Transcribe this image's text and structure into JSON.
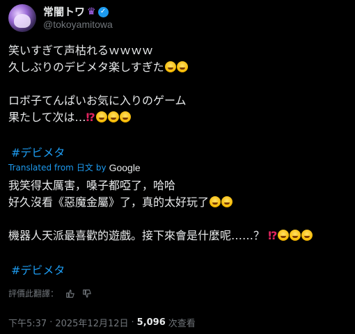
{
  "author": {
    "display_name": "常闇トワ",
    "emblem": "♛",
    "handle": "@tokoyamitowa",
    "verified_color": "#1d9bf0",
    "accent_color": "#b26cff"
  },
  "original": {
    "line1": "笑いすぎて声枯れるｗｗｗｗ",
    "line2": "久しぶりのデビメタ楽しすぎた",
    "line3": "ロボ子てんぱいお気に入りのゲーム",
    "line4": "果たして次は…",
    "hashtag": "#デビメタ"
  },
  "translation": {
    "label_prefix": "Translated from",
    "source_lang": "日文",
    "by": "by",
    "provider": "Google",
    "line1": "我笑得太厲害，嗓子都啞了，哈哈",
    "line2": "好久沒看《惡魔金屬》了，真的太好玩了",
    "line3": "機器人天派最喜歡的遊戲。接下來會是什麼呢……？",
    "hashtag": "#デビメタ"
  },
  "rate": {
    "label": "評價此翻譯："
  },
  "footer": {
    "time": "下午5:37",
    "sep1": "·",
    "date": "2025年12月12日",
    "sep2": "·",
    "views": "5,096",
    "views_label": "次查看"
  },
  "icons": {
    "emoji": "rolling-laughing-emoji",
    "exclaim": "interrobang"
  }
}
